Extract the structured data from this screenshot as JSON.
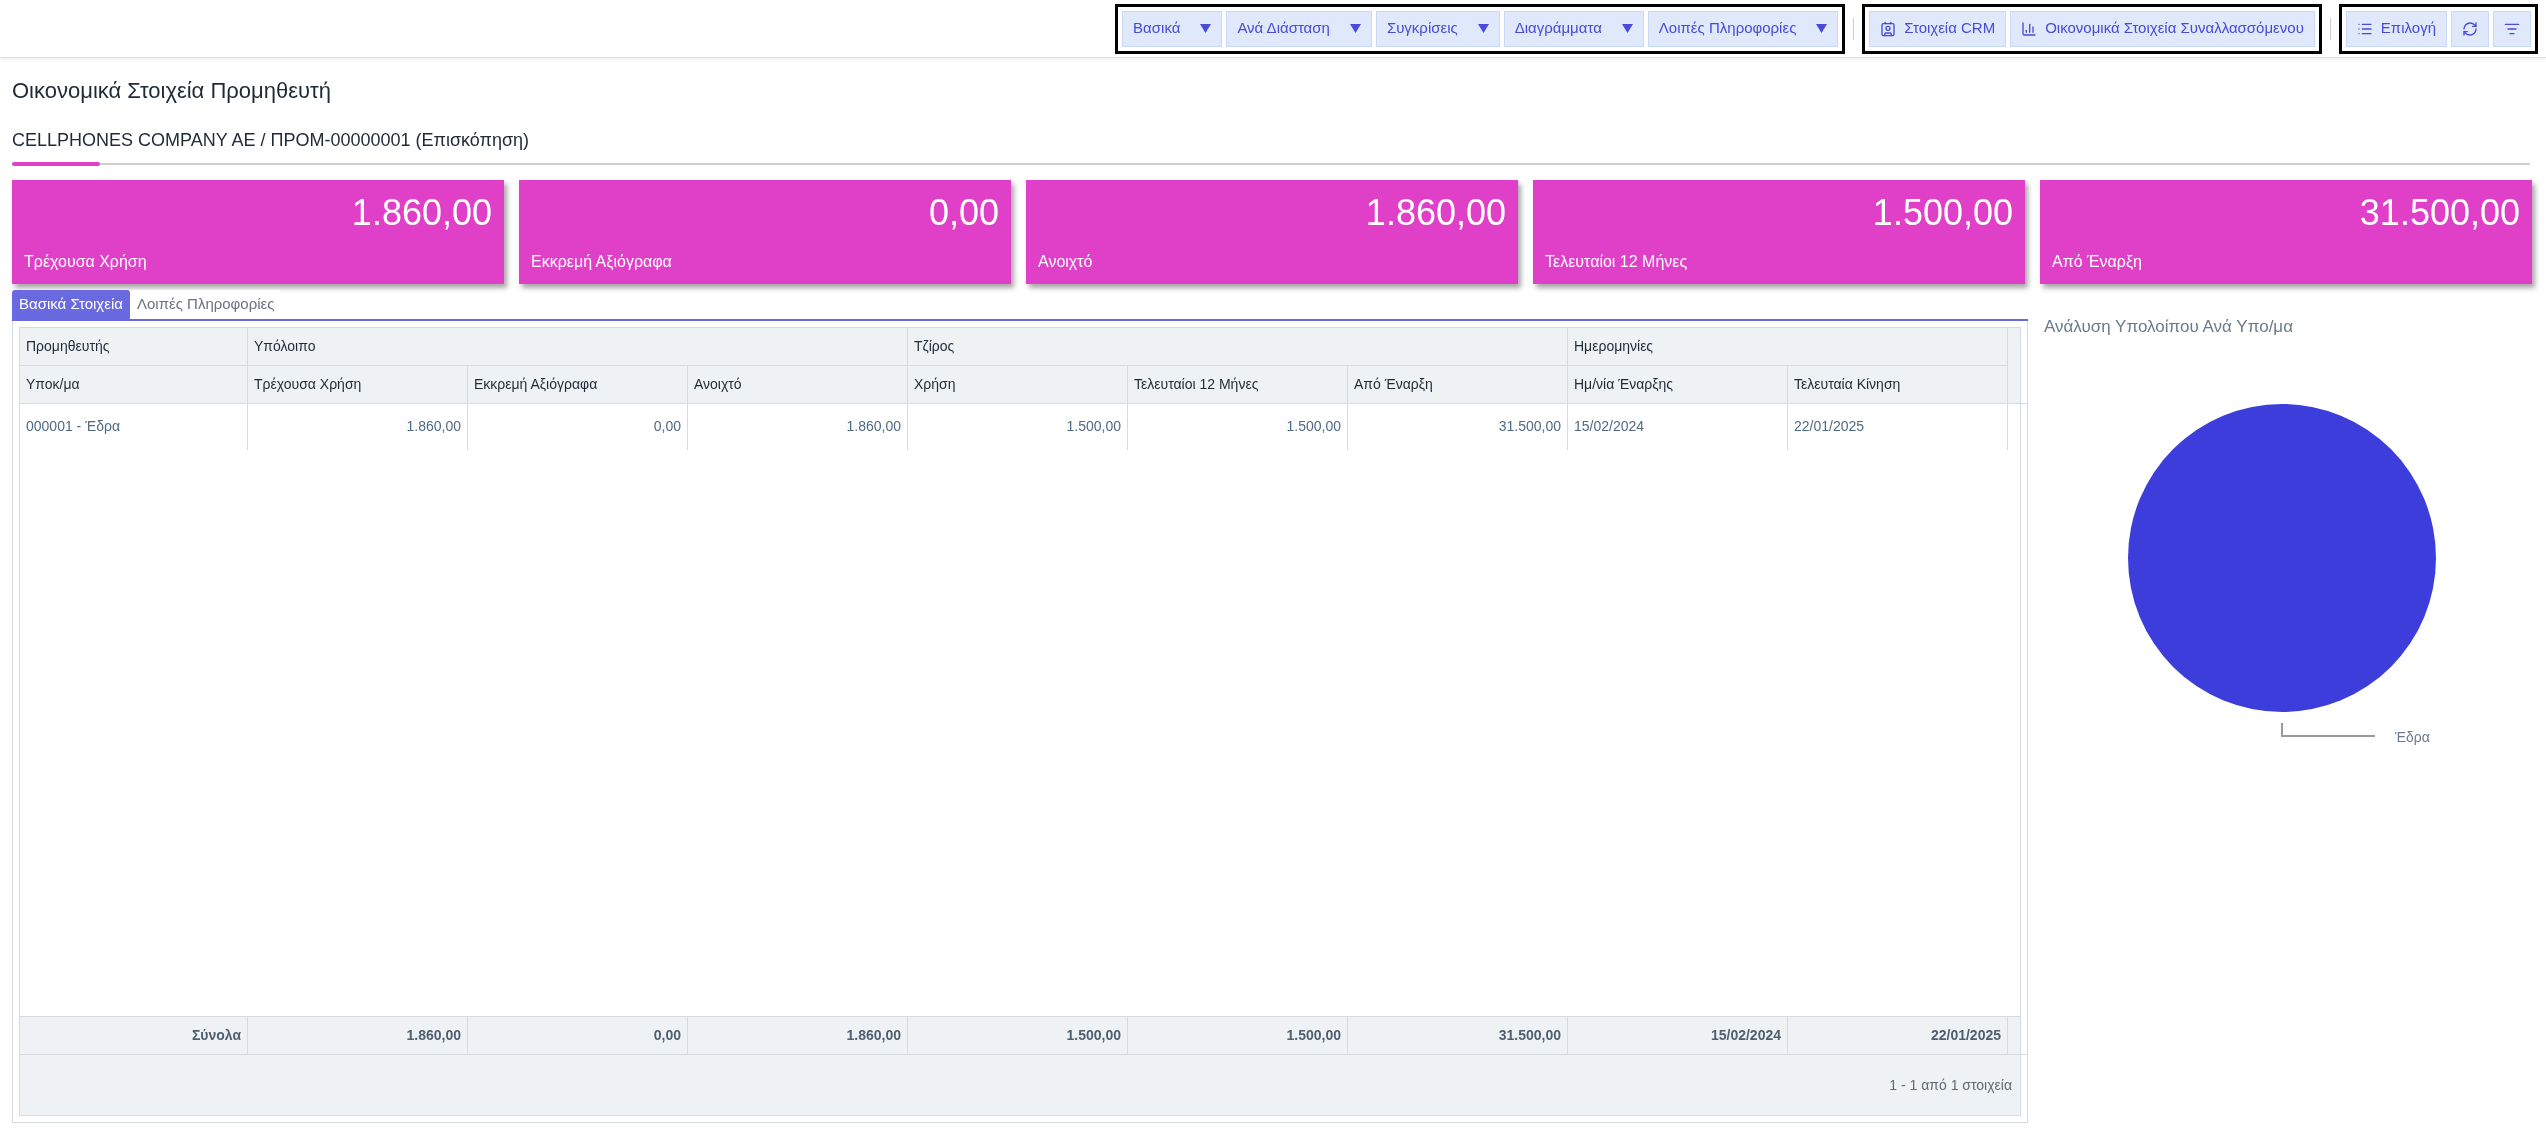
{
  "toolbar": {
    "groups": [
      {
        "buttons": [
          {
            "kind": "dropdown",
            "label": "Βασικά"
          },
          {
            "kind": "dropdown",
            "label": "Ανά Διάσταση"
          },
          {
            "kind": "dropdown",
            "label": "Συγκρίσεις"
          },
          {
            "kind": "dropdown",
            "label": "Διαγράμματα"
          },
          {
            "kind": "dropdown",
            "label": "Λοιπές Πληροφορίες"
          }
        ]
      },
      {
        "buttons": [
          {
            "kind": "contact",
            "label": "Στοιχεία CRM"
          },
          {
            "kind": "chart",
            "label": "Οικονομικά Στοιχεία Συναλλασσόμενου"
          }
        ]
      },
      {
        "buttons": [
          {
            "kind": "list",
            "label": "Επιλογή"
          },
          {
            "kind": "refresh"
          },
          {
            "kind": "filter"
          }
        ]
      }
    ]
  },
  "page": {
    "title": "Οικονομικά Στοιχεία Προμηθευτή",
    "subtitle": "CELLPHONES COMPANY AE / ΠΡΟΜ-00000001 (Επισκόπηση)"
  },
  "cards": [
    {
      "value": "1.860,00",
      "label": "Τρέχουσα Χρήση"
    },
    {
      "value": "0,00",
      "label": "Εκκρεμή Αξιόγραφα"
    },
    {
      "value": "1.860,00",
      "label": "Ανοιχτό"
    },
    {
      "value": "1.500,00",
      "label": "Τελευταίοι 12 Μήνες"
    },
    {
      "value": "31.500,00",
      "label": "Από Έναρξη"
    }
  ],
  "tabs": [
    {
      "label": "Βασικά Στοιχεία",
      "selected": true
    },
    {
      "label": "Λοιπές Πληροφορίες",
      "selected": false
    }
  ],
  "table": {
    "header_groups": [
      {
        "label": "Προμηθευτής",
        "columns": [
          {
            "label": "Υποκ/μα",
            "kind": "link"
          }
        ]
      },
      {
        "label": "Υπόλοιπο",
        "columns": [
          {
            "label": "Τρέχουσα Χρήση",
            "kind": "amount"
          },
          {
            "label": "Εκκρεμή Αξιόγραφα",
            "kind": "amount"
          },
          {
            "label": "Ανοιχτό",
            "kind": "amount"
          }
        ]
      },
      {
        "label": "Τζίρος",
        "columns": [
          {
            "label": "Χρήση",
            "kind": "amount"
          },
          {
            "label": "Τελευταίοι 12 Μήνες",
            "kind": "amount"
          },
          {
            "label": "Από Έναρξη",
            "kind": "amount"
          }
        ]
      },
      {
        "label": "Ημερομηνίες",
        "columns": [
          {
            "label": "Ημ/νία Έναρξης",
            "kind": "date"
          },
          {
            "label": "Τελευταία Κίνηση",
            "kind": "date"
          }
        ]
      }
    ],
    "rows": [
      {
        "cells": [
          "000001 - Έδρα",
          "1.860,00",
          "0,00",
          "1.860,00",
          "1.500,00",
          "1.500,00",
          "31.500,00",
          "15/02/2024",
          "22/01/2025"
        ]
      }
    ],
    "totals": {
      "label": "Σύνολα",
      "cells": [
        "1.860,00",
        "0,00",
        "1.860,00",
        "1.500,00",
        "1.500,00",
        "31.500,00",
        "15/02/2024",
        "22/01/2025"
      ]
    },
    "pagination": "1 - 1 από 1 στοιχεία"
  },
  "side_chart": {
    "chart_data": {
      "type": "pie",
      "title": "Ανάλυση Υπολοίπου Ανά Υπο/μα",
      "categories": [
        "Έδρα"
      ],
      "series": [
        {
          "color": "#3d3ddc",
          "values": [
            100
          ]
        }
      ]
    }
  }
}
